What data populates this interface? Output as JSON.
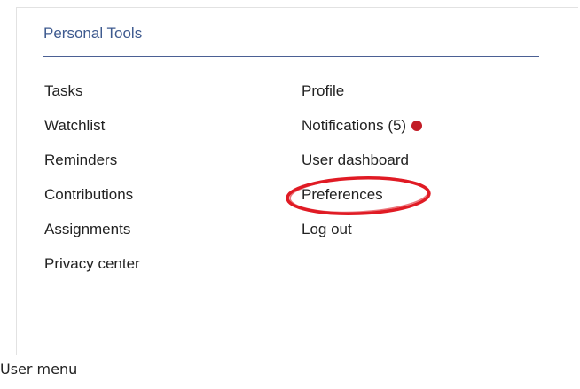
{
  "personal_tools": {
    "title": "Personal Tools",
    "left_column": [
      {
        "label": "Tasks"
      },
      {
        "label": "Watchlist"
      },
      {
        "label": "Reminders"
      },
      {
        "label": "Contributions"
      },
      {
        "label": "Assignments"
      },
      {
        "label": "Privacy center"
      }
    ],
    "right_column": [
      {
        "label": "Profile"
      },
      {
        "label": "Notifications (5)"
      },
      {
        "label": "User dashboard"
      },
      {
        "label": "Preferences"
      },
      {
        "label": "Log out"
      }
    ]
  },
  "colors": {
    "title": "#3e5a8f",
    "notification_dot": "#c21d27",
    "highlight": "#e01b24"
  },
  "caption": "User menu"
}
